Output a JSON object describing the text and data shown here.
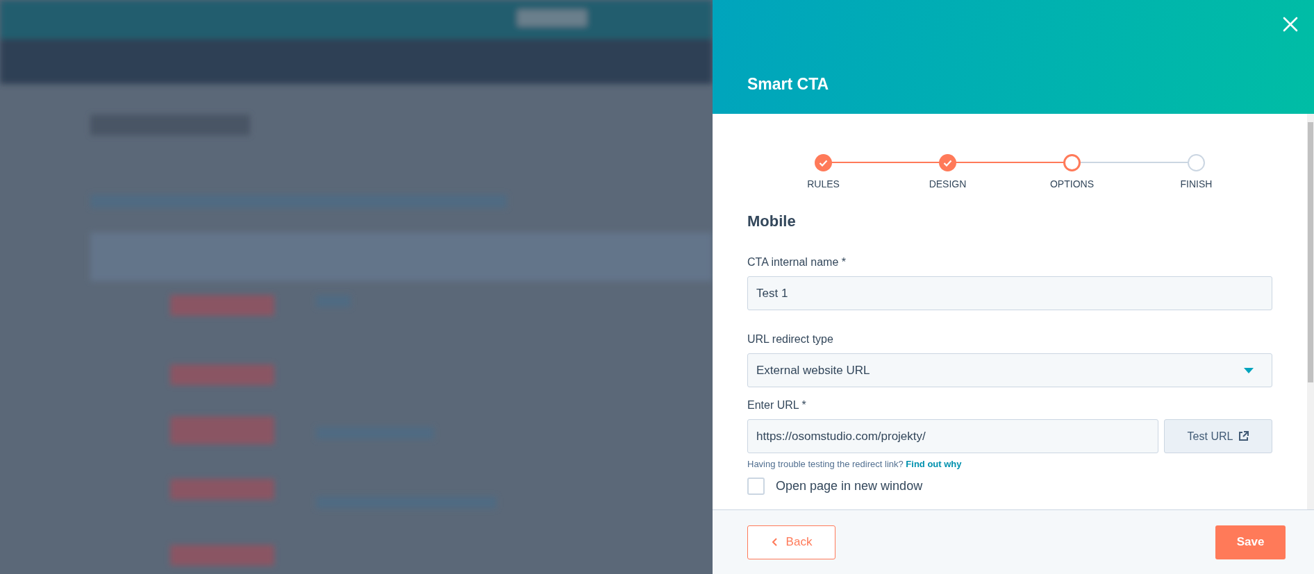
{
  "panel": {
    "title": "Smart CTA",
    "steps": [
      {
        "label": "RULES",
        "kind": "done"
      },
      {
        "label": "DESIGN",
        "kind": "done"
      },
      {
        "label": "OPTIONS",
        "kind": "current"
      },
      {
        "label": "FINISH",
        "kind": "upcoming"
      }
    ],
    "section_title": "Mobile",
    "fields": [
      {
        "label": "CTA internal name *",
        "kind": "text",
        "value": "Test 1"
      },
      {
        "label": "URL redirect type",
        "kind": "select",
        "value": "External website URL"
      },
      {
        "label": "Enter URL *",
        "kind": "url",
        "value": "https://osomstudio.com/projekty/",
        "button": "Test URL"
      }
    ],
    "help": {
      "text": "Having trouble testing the redirect link?",
      "link": "Find out why"
    },
    "checkbox": {
      "label": "Open page in new window",
      "checked": false
    },
    "footer": {
      "back": "Back",
      "save": "Save"
    }
  }
}
